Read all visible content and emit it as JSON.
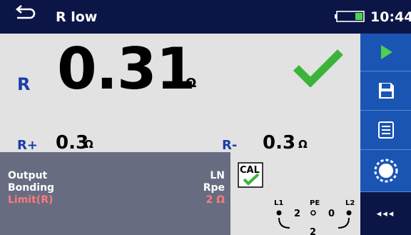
{
  "header": {
    "title": "R low",
    "time": "10:44",
    "back_icon": "back-arrow-icon",
    "battery_icon": "battery-icon"
  },
  "result": {
    "r_label": "R",
    "r_value": "0.31",
    "r_unit": "Ω",
    "status_icon": "check-icon"
  },
  "sub_results": {
    "rplus": {
      "label": "R+",
      "value": "0.3",
      "unit": "Ω"
    },
    "rminus": {
      "label": "R-",
      "value": "0.3",
      "unit": "Ω"
    }
  },
  "parameters": [
    {
      "label": "Output",
      "value": "LN"
    },
    {
      "label": "Bonding",
      "value": "Rpe"
    },
    {
      "label": "Limit(R)",
      "value": "2 Ω"
    }
  ],
  "cal_badge": "CAL",
  "connection": {
    "terminals": [
      "L1",
      "PE",
      "L2"
    ],
    "values_between": [
      "2",
      "0"
    ],
    "value_bottom": "2"
  },
  "toolbar": {
    "items": [
      "play-icon",
      "save-icon",
      "list-icon",
      "calibrate-icon",
      "more-icon"
    ],
    "more_label": "◂◂◂"
  },
  "colors": {
    "header_bg": "#0b1646",
    "toolbar_bg": "#1a55b4",
    "accent_blue": "#1a3fa8",
    "check_green": "#3cb43c",
    "limit_red": "#ff7a7a",
    "panel_bg": "#676c81"
  }
}
